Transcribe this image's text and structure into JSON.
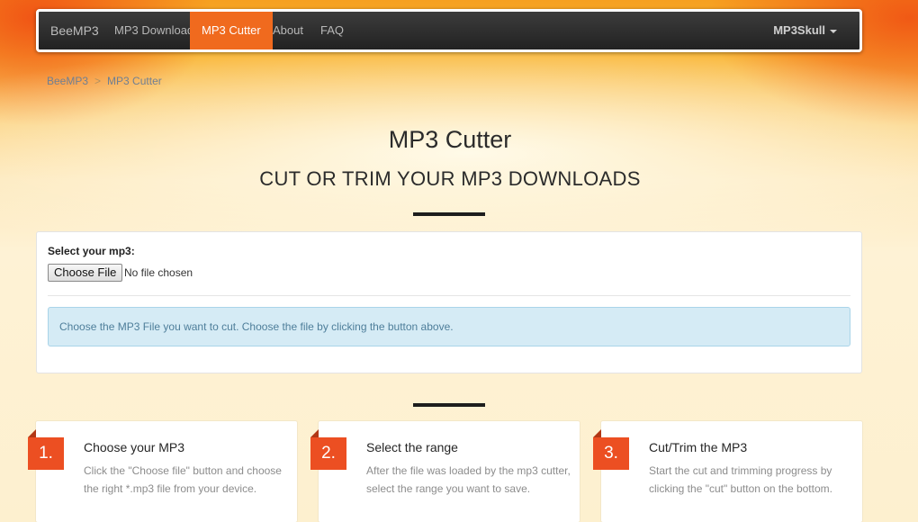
{
  "nav": {
    "brand": "BeeMP3",
    "items": [
      {
        "label": "MP3 Download",
        "active": false
      },
      {
        "label": "MP3 Cutter",
        "active": true
      },
      {
        "label": "About",
        "active": false
      },
      {
        "label": "FAQ",
        "active": false
      }
    ],
    "right_menu": "MP3Skull"
  },
  "breadcrumb": [
    "BeeMP3",
    "MP3 Cutter"
  ],
  "header": {
    "title": "MP3 Cutter",
    "subtitle": "CUT OR TRIM YOUR MP3 DOWNLOADS"
  },
  "upload": {
    "label": "Select your mp3:",
    "button": "Choose File",
    "status": "No file chosen",
    "info": "Choose the MP3 File you want to cut. Choose the file by clicking the button above."
  },
  "steps": [
    {
      "number": "1.",
      "title": "Choose your MP3",
      "desc": "Click the \"Choose file\" button and choose the right *.mp3 file from your device."
    },
    {
      "number": "2.",
      "title": "Select the range",
      "desc": "After the file was loaded by the mp3 cutter, select the range you want to save."
    },
    {
      "number": "3.",
      "title": "Cut/Trim the MP3",
      "desc": "Start the cut and trimming progress by clicking the \"cut\" button on the bottom."
    }
  ],
  "colors": {
    "accent": "#f06a1e",
    "step_badge": "#ec4f22",
    "navbar": "#2b2b2b"
  }
}
